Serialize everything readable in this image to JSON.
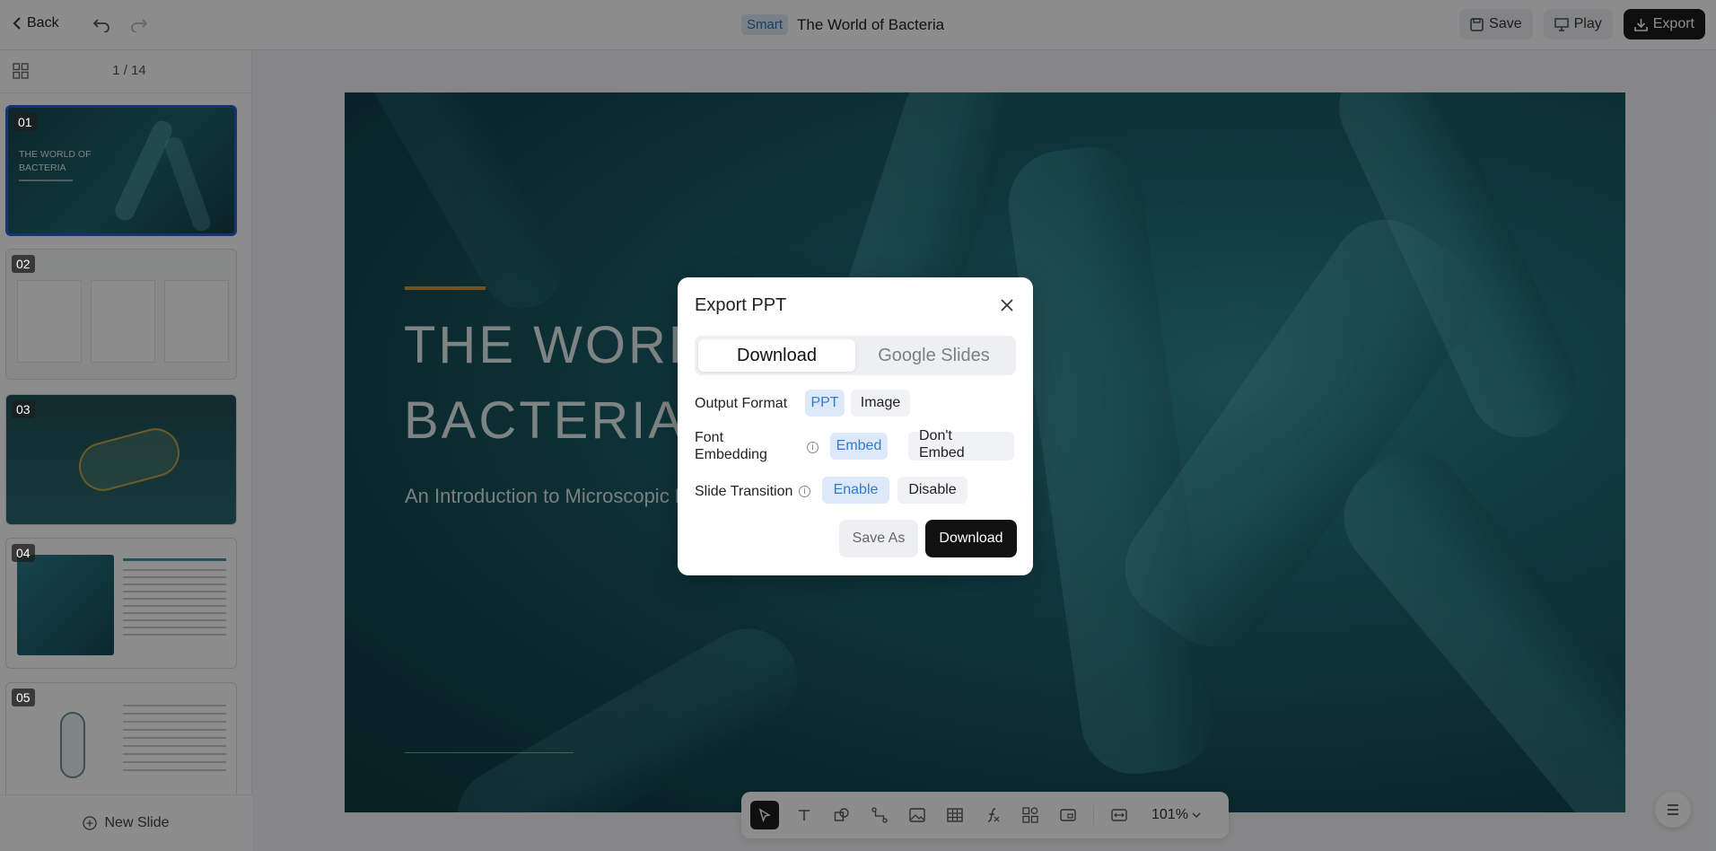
{
  "topbar": {
    "back_label": "Back",
    "badge": "Smart",
    "title": "The World of Bacteria",
    "save_label": "Save",
    "play_label": "Play",
    "export_label": "Export"
  },
  "sidebar": {
    "page_count": "1 / 14",
    "slides": [
      {
        "num": "01",
        "text": "THE WORLD OF BACTERIA"
      },
      {
        "num": "02",
        "text": ""
      },
      {
        "num": "03",
        "text": ""
      },
      {
        "num": "04",
        "text": ""
      },
      {
        "num": "05",
        "text": ""
      }
    ],
    "new_slide_label": "New Slide"
  },
  "slide": {
    "title_line1": "THE WORLD OF",
    "title_line2": "BACTERIA",
    "subtitle": "An Introduction to Microscopic Life"
  },
  "toolbar": {
    "zoom": "101%"
  },
  "modal": {
    "title": "Export PPT",
    "tab_download": "Download",
    "tab_google": "Google Slides",
    "output_format_label": "Output Format",
    "format_ppt": "PPT",
    "format_image": "Image",
    "font_embedding_label_1": "Font",
    "font_embedding_label_2": "Embedding",
    "embed": "Embed",
    "dont_embed_1": "Don't",
    "dont_embed_2": "Embed",
    "slide_transition_label": "Slide Transition",
    "enable": "Enable",
    "disable": "Disable",
    "save_as": "Save As",
    "download": "Download"
  },
  "colors": {
    "accent": "#2f7ad0",
    "dark_button": "#111111",
    "slide_bg": "#1c6670"
  }
}
